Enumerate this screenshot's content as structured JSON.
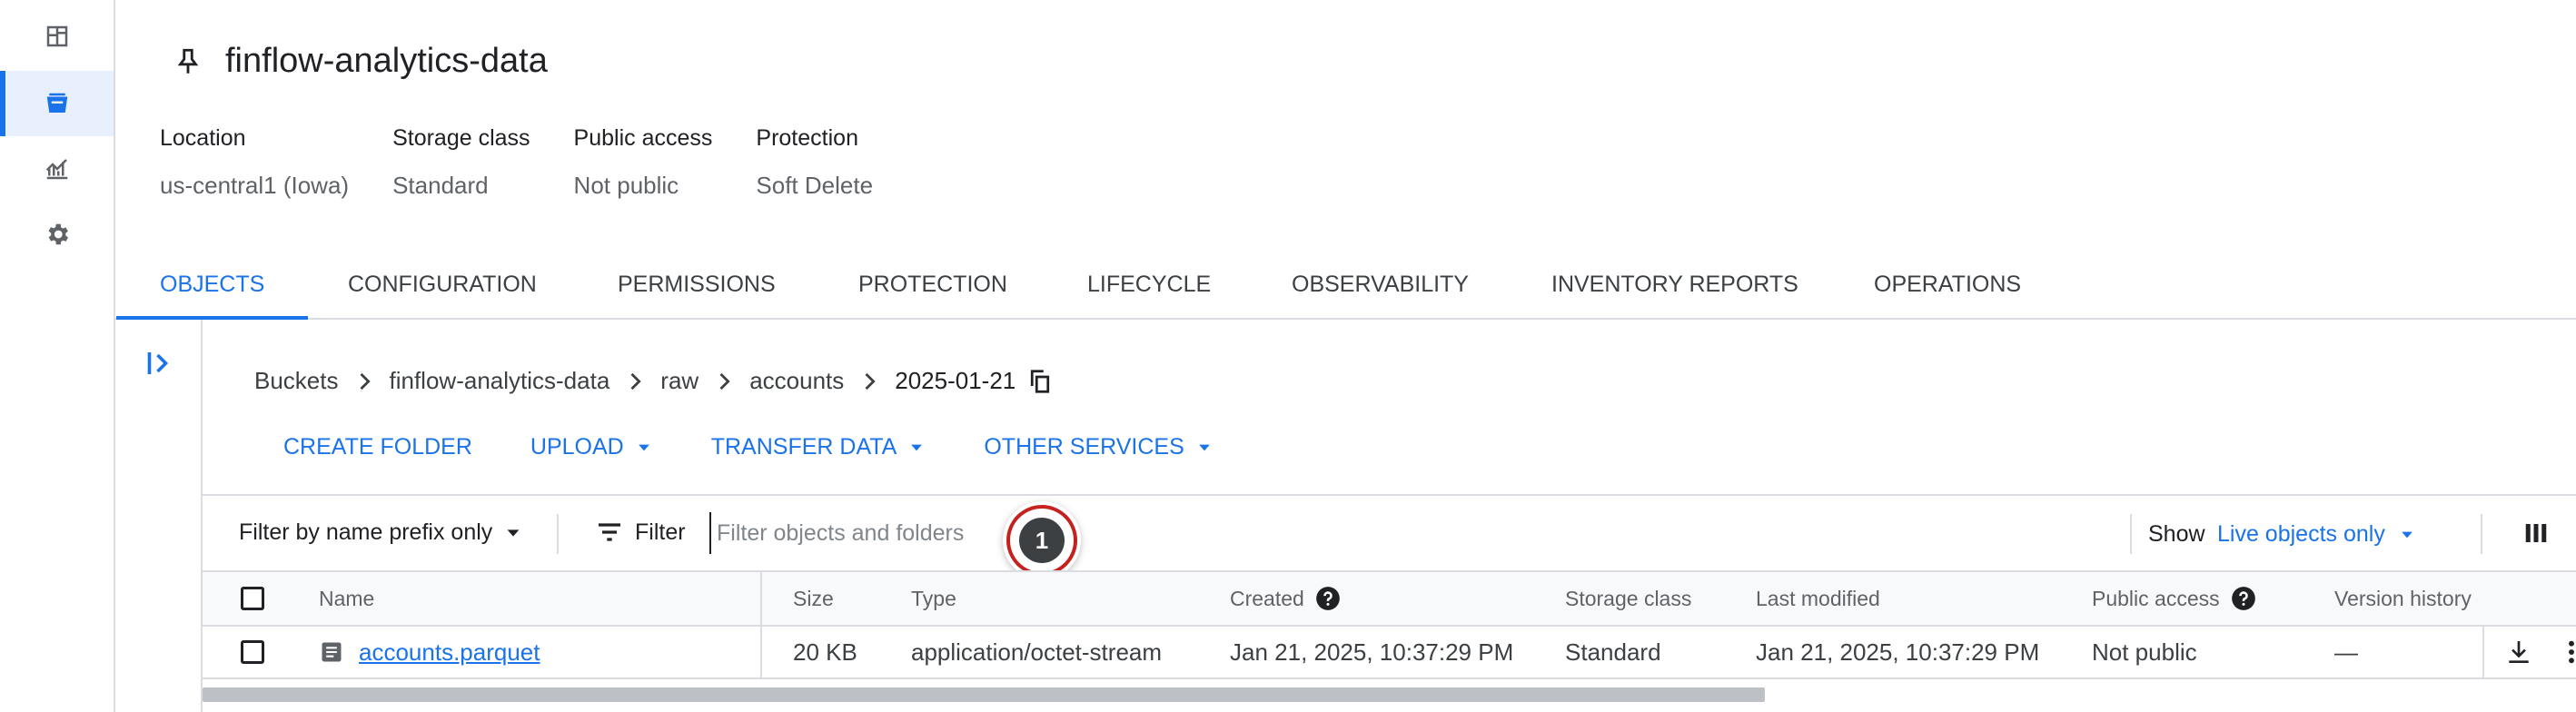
{
  "rail": {
    "items": [
      {
        "icon": "dashboard-icon"
      },
      {
        "icon": "bucket-icon",
        "active": true
      },
      {
        "icon": "monitoring-icon"
      },
      {
        "icon": "settings-icon"
      }
    ]
  },
  "header": {
    "title": "finflow-analytics-data",
    "icon": "pin-icon"
  },
  "meta": [
    {
      "label": "Location",
      "value": "us-central1 (Iowa)"
    },
    {
      "label": "Storage class",
      "value": "Standard"
    },
    {
      "label": "Public access",
      "value": "Not public"
    },
    {
      "label": "Protection",
      "value": "Soft Delete"
    }
  ],
  "tabs": [
    {
      "label": "OBJECTS",
      "active": true
    },
    {
      "label": "CONFIGURATION"
    },
    {
      "label": "PERMISSIONS"
    },
    {
      "label": "PROTECTION"
    },
    {
      "label": "LIFECYCLE"
    },
    {
      "label": "OBSERVABILITY"
    },
    {
      "label": "INVENTORY REPORTS"
    },
    {
      "label": "OPERATIONS"
    }
  ],
  "breadcrumb": [
    "Buckets",
    "finflow-analytics-data",
    "raw",
    "accounts",
    "2025-01-21"
  ],
  "actions": {
    "create_folder": "CREATE FOLDER",
    "upload": "UPLOAD",
    "transfer_data": "TRANSFER DATA",
    "other_services": "OTHER SERVICES"
  },
  "filter": {
    "prefix_mode": "Filter by name prefix only",
    "button": "Filter",
    "placeholder": "Filter objects and folders",
    "show_label": "Show",
    "show_value": "Live objects only"
  },
  "step_badge": "1",
  "table": {
    "columns": {
      "name": "Name",
      "size": "Size",
      "type": "Type",
      "created": "Created",
      "storage_class": "Storage class",
      "last_modified": "Last modified",
      "public_access": "Public access",
      "version_history": "Version history"
    },
    "rows": [
      {
        "name": "accounts.parquet",
        "size": "20 KB",
        "type": "application/octet-stream",
        "created": "Jan 21, 2025, 10:37:29 PM",
        "storage_class": "Standard",
        "last_modified": "Jan 21, 2025, 10:37:29 PM",
        "public_access": "Not public",
        "version_history": "—"
      }
    ]
  },
  "colors": {
    "accent": "#1a73e8",
    "border": "#dadce0",
    "badge_ring": "#c5221f"
  }
}
